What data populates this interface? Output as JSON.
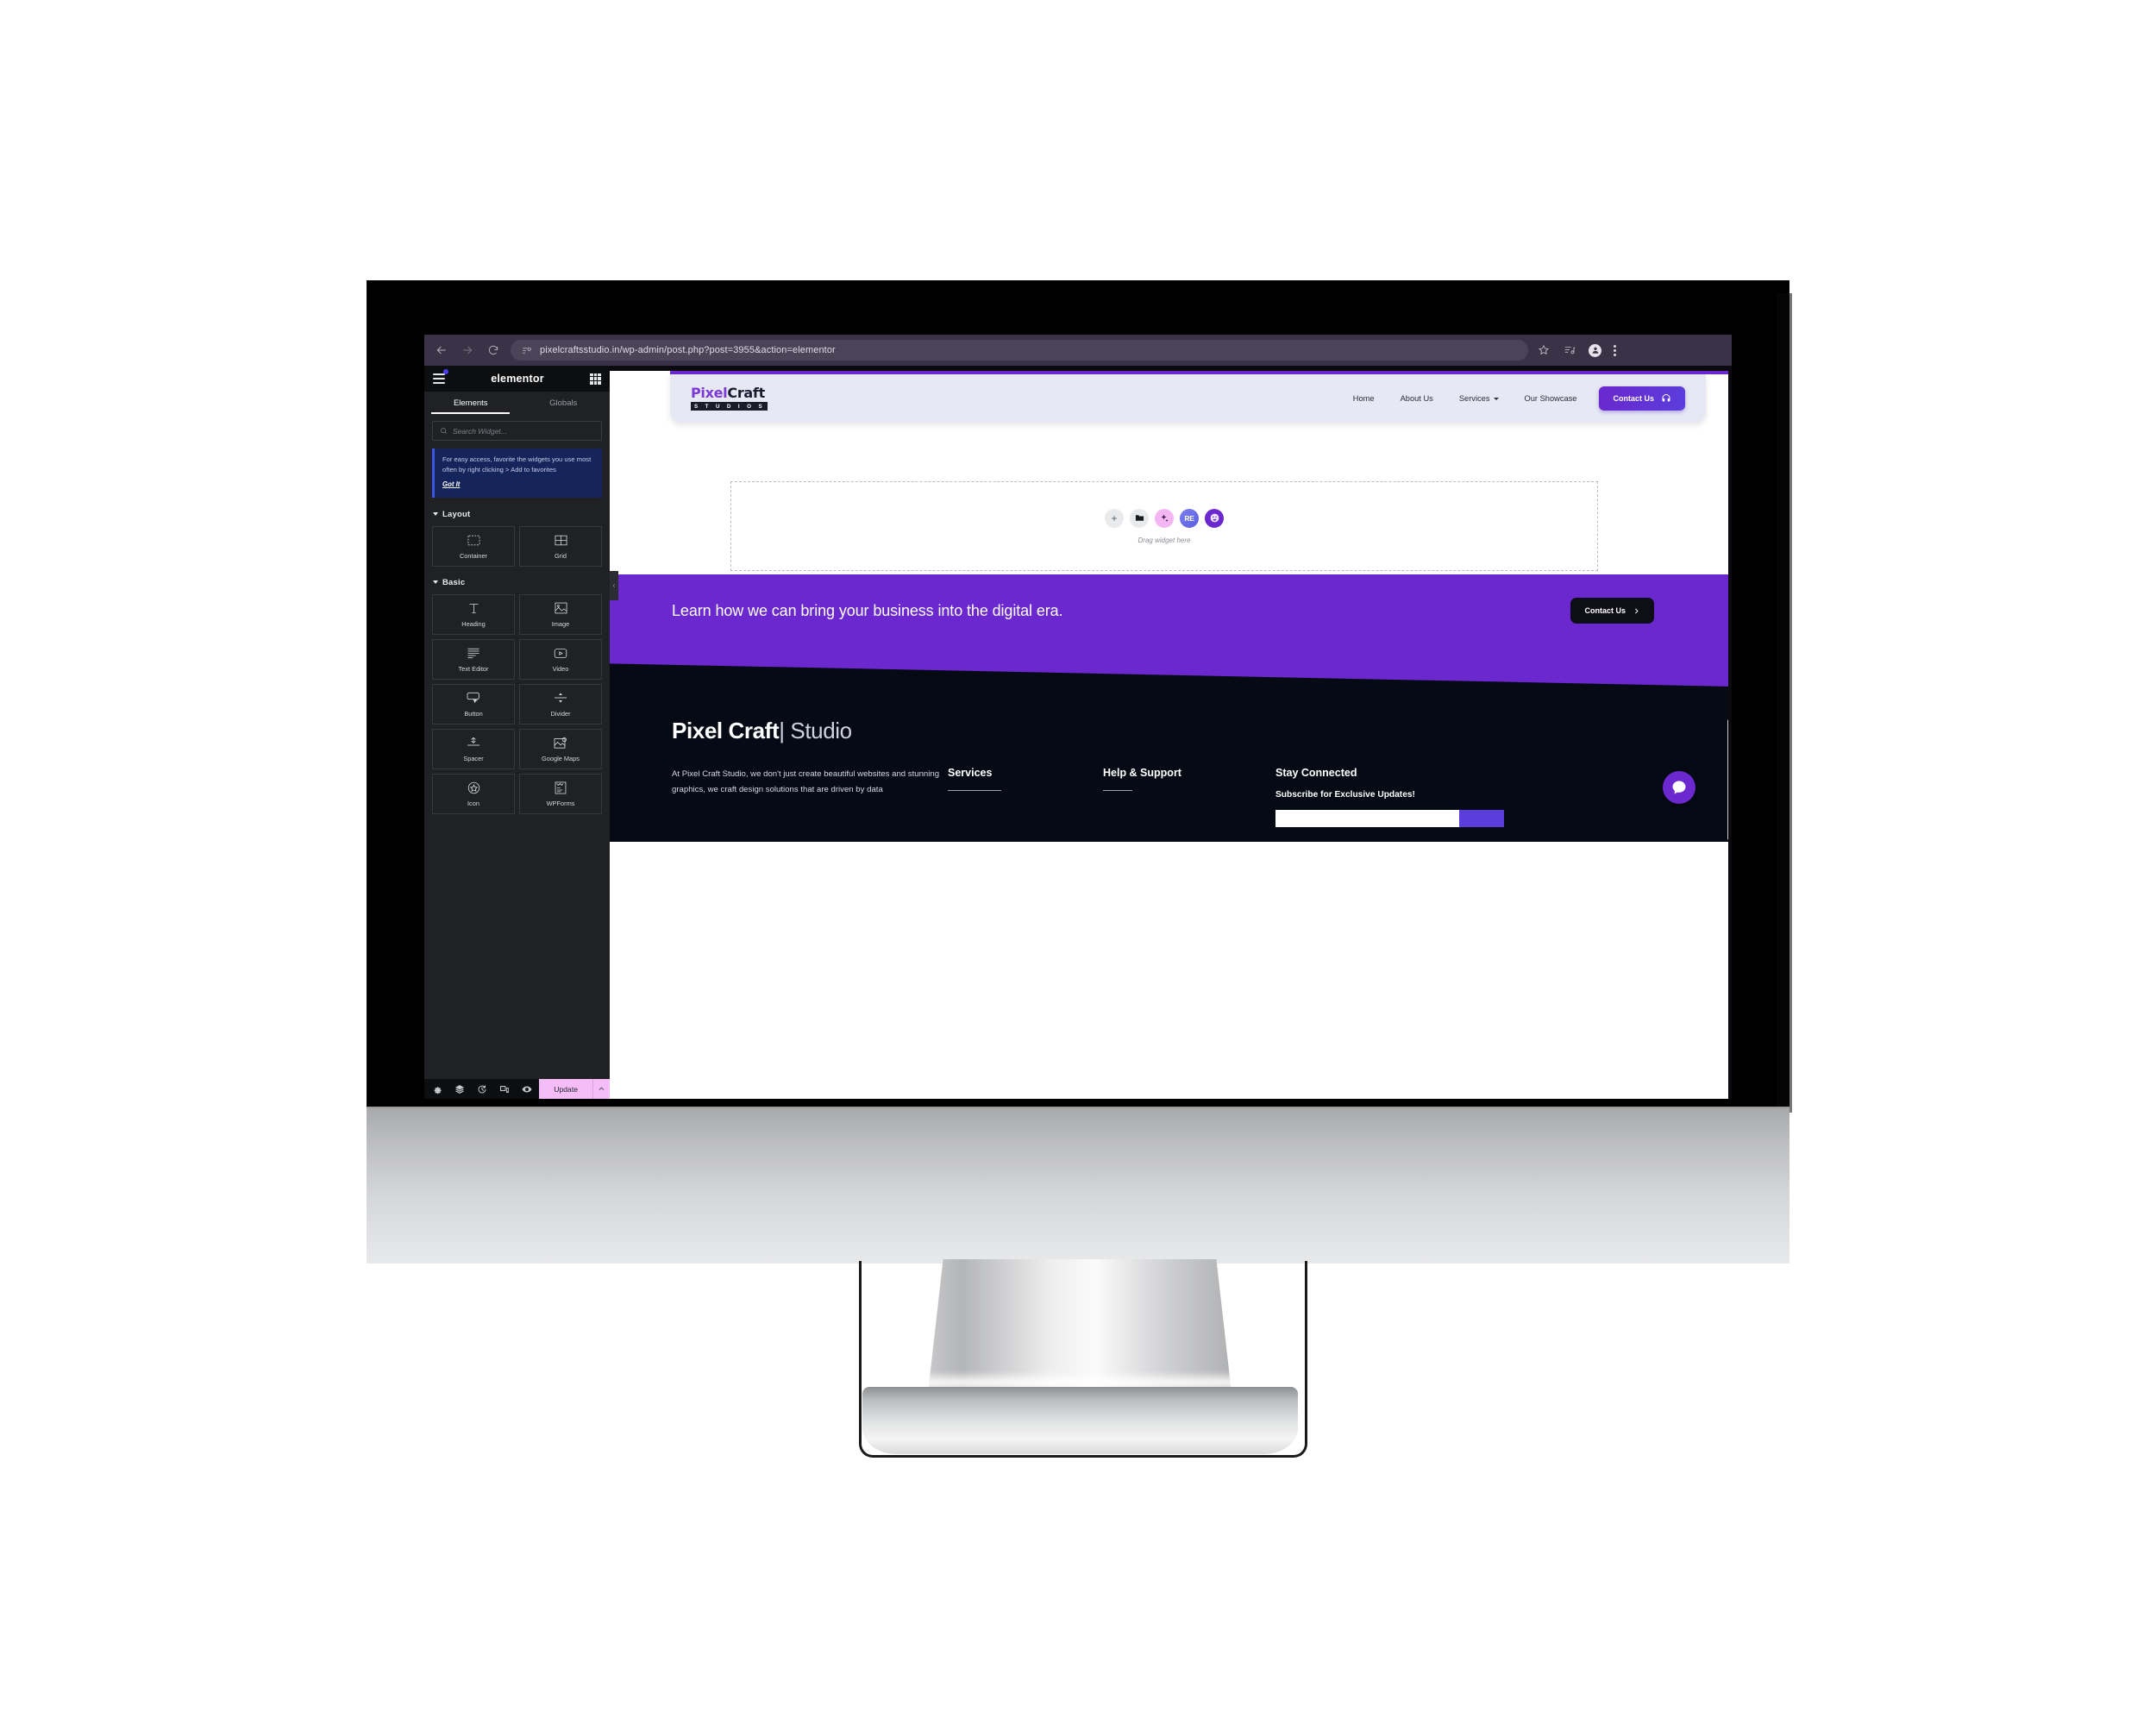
{
  "browser": {
    "url": "pixelcraftsstudio.in/wp-admin/post.php?post=3955&action=elementor",
    "back_label": "Back",
    "forward_label": "Forward",
    "reload_label": "Reload",
    "site_info_label": "View site information",
    "bookmark_label": "Bookmark this tab",
    "reading_list_label": "Reading list",
    "profile_label": "Profile",
    "menu_label": "Customize and control Chrome"
  },
  "elementor": {
    "logo": "elementor",
    "menu_label": "Menu",
    "structure_label": "Structure",
    "tabs": [
      {
        "label": "Elements",
        "active": true
      },
      {
        "label": "Globals",
        "active": false
      }
    ],
    "search": {
      "placeholder": "Search Widget..."
    },
    "notice": {
      "text": "For easy access, favorite the widgets you use most often by right clicking > Add to favorites",
      "link": "Got It"
    },
    "sections": [
      {
        "title": "Layout",
        "widgets": [
          {
            "label": "Container",
            "icon": "container-icon"
          },
          {
            "label": "Grid",
            "icon": "grid-icon"
          }
        ]
      },
      {
        "title": "Basic",
        "widgets": [
          {
            "label": "Heading",
            "icon": "heading-icon"
          },
          {
            "label": "Image",
            "icon": "image-icon"
          },
          {
            "label": "Text Editor",
            "icon": "text-editor-icon"
          },
          {
            "label": "Video",
            "icon": "video-icon"
          },
          {
            "label": "Button",
            "icon": "button-icon"
          },
          {
            "label": "Divider",
            "icon": "divider-icon"
          },
          {
            "label": "Spacer",
            "icon": "spacer-icon"
          },
          {
            "label": "Google Maps",
            "icon": "google-maps-icon"
          },
          {
            "label": "Icon",
            "icon": "star-icon"
          },
          {
            "label": "WPForms",
            "icon": "wpforms-icon"
          }
        ]
      }
    ],
    "footer": {
      "icons": [
        {
          "name": "settings-icon",
          "label": "Settings"
        },
        {
          "name": "layers-icon",
          "label": "Navigator"
        },
        {
          "name": "history-icon",
          "label": "History"
        },
        {
          "name": "responsive-icon",
          "label": "Responsive Mode"
        },
        {
          "name": "preview-icon",
          "label": "Preview Changes"
        }
      ],
      "update_label": "Update",
      "update_caret_label": "More save options"
    },
    "collapse_label": "Collapse panel"
  },
  "site": {
    "logo": {
      "part1": "Pixel",
      "part2": "Craft",
      "sub": "S T U D I O S"
    },
    "nav": [
      {
        "label": "Home",
        "dropdown": false
      },
      {
        "label": "About Us",
        "dropdown": false
      },
      {
        "label": "Services",
        "dropdown": true
      },
      {
        "label": "Our Showcase",
        "dropdown": false
      }
    ],
    "header_cta": {
      "label": "Contact Us",
      "icon": "headset-icon"
    },
    "dropzone": {
      "label": "Drag widget here",
      "actions": [
        {
          "name": "add-widget-icon",
          "glyph": "plus"
        },
        {
          "name": "folder-icon",
          "glyph": "folder"
        },
        {
          "name": "ai-sparkle-icon",
          "glyph": "sparkle"
        },
        {
          "name": "royal-elementor-icon",
          "glyph": "RE"
        },
        {
          "name": "avatar-widget-icon",
          "glyph": "avatar"
        }
      ]
    },
    "cta_band": {
      "text": "Learn how we can bring your business into the digital era.",
      "button": "Contact Us",
      "button_icon": "chevron-right-icon"
    },
    "footer": {
      "brand_bold": "Pixel Craft",
      "brand_light": "| Studio",
      "about": "At Pixel Craft Studio, we don't just create beautiful websites and stunning graphics, we craft design solutions that are driven by data",
      "col_services": "Services",
      "col_help": "Help & Support",
      "col_stay": "Stay Connected",
      "subscribe_title": "Subscribe for Exclusive Updates!",
      "subscribe_placeholder": ""
    },
    "chat_widget": {
      "name": "chat-bubble-icon",
      "label": "Open chat"
    }
  },
  "colors": {
    "brand_purple": "#6a28ce",
    "accent_blue": "#5b3ddb",
    "update_pink": "#f4bdf7",
    "panel_dark": "#1f2124",
    "footer_dark": "#060a15",
    "header_bg": "#e6e9f4"
  }
}
